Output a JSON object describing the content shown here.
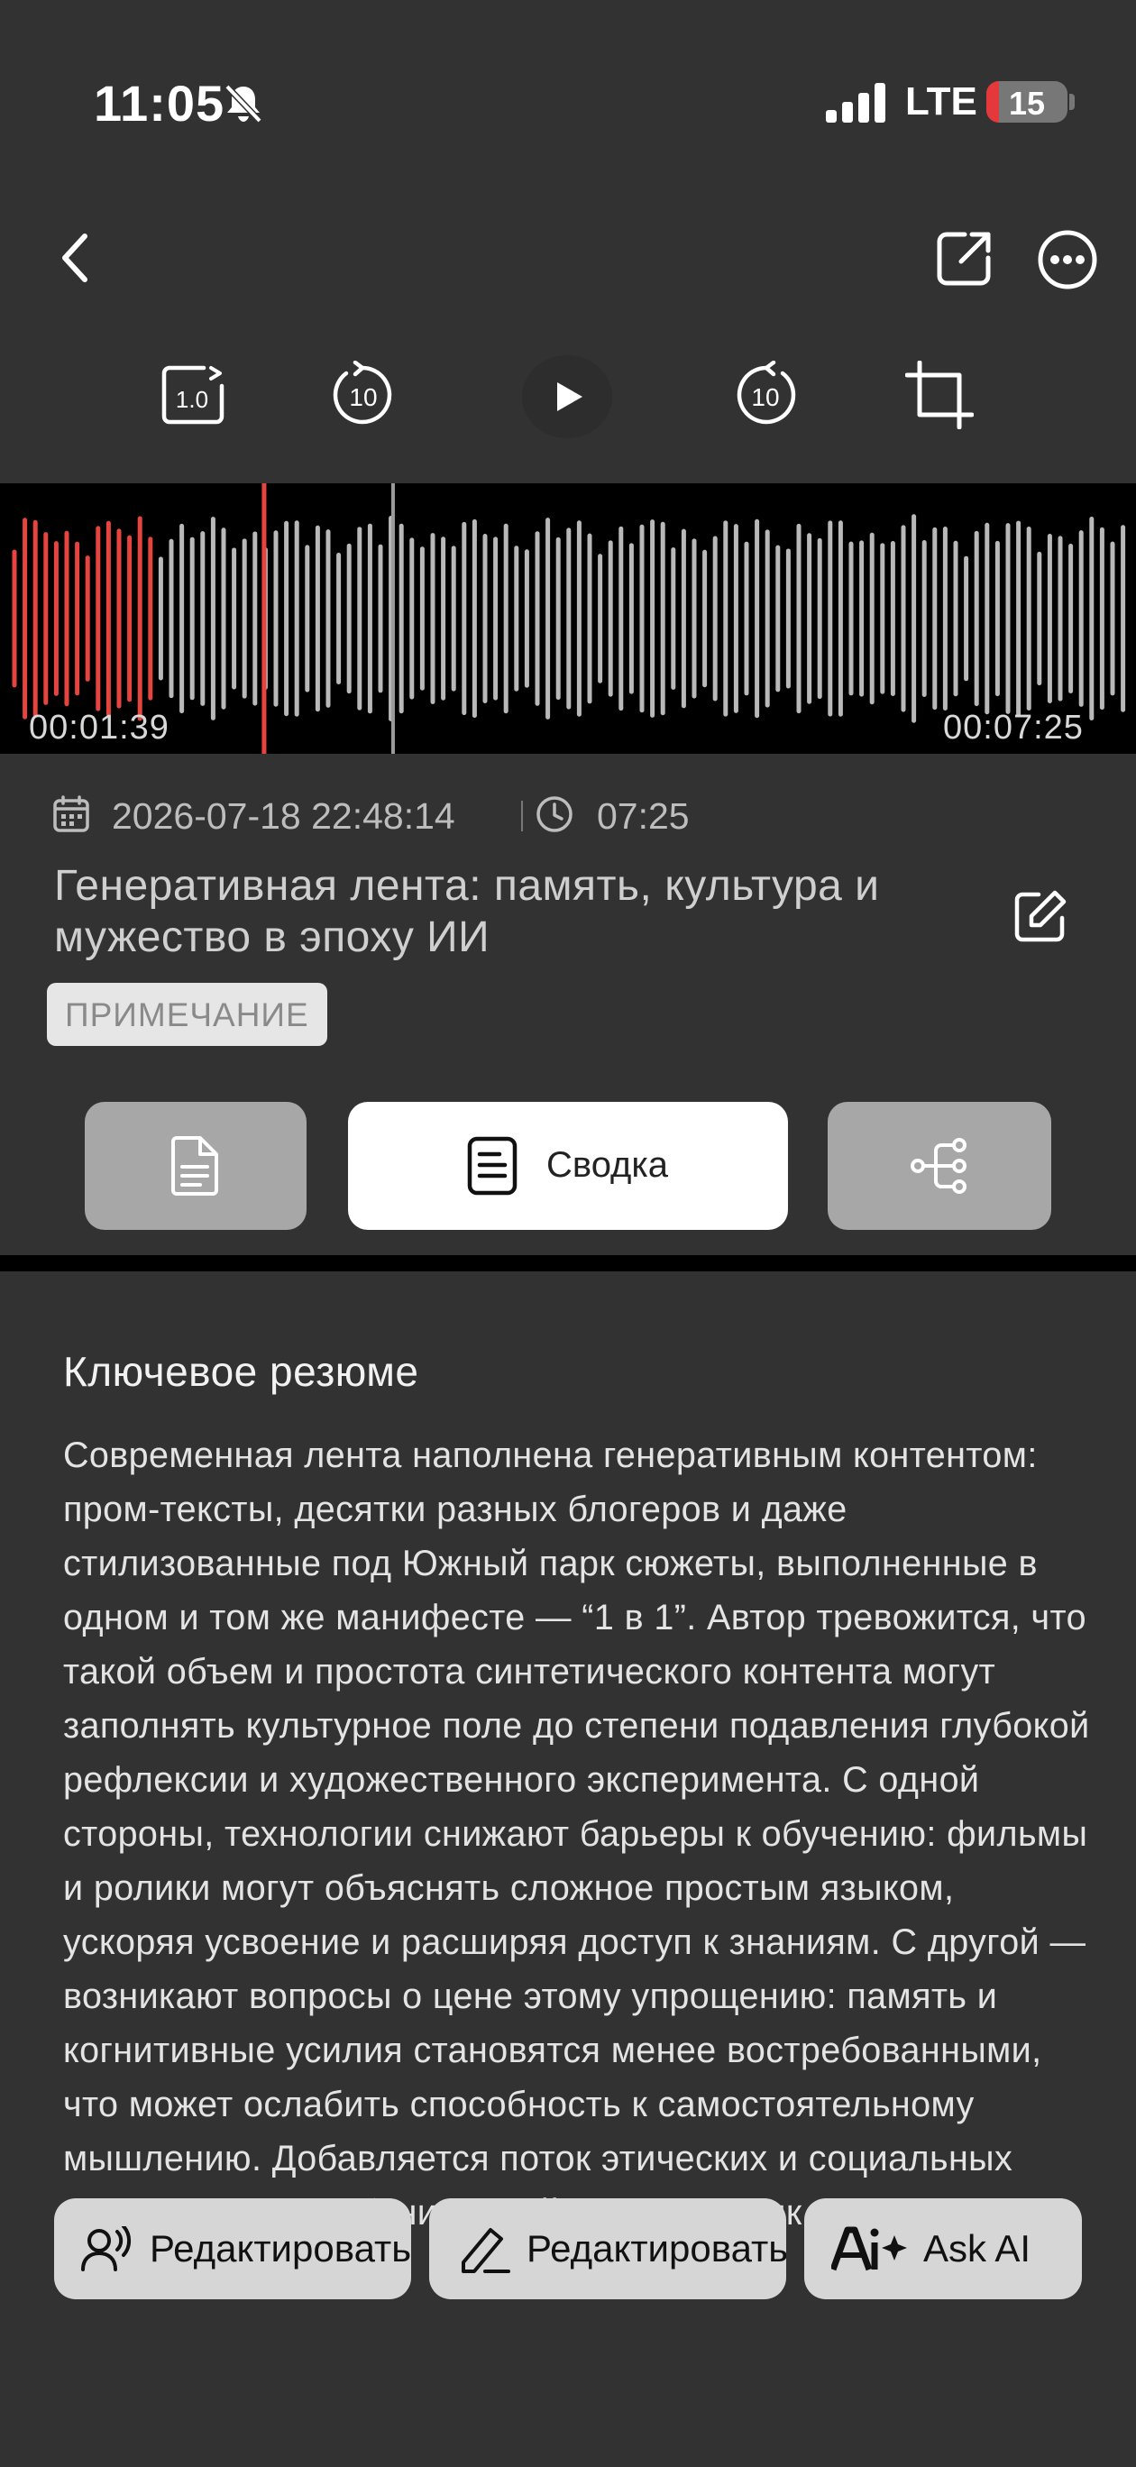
{
  "status_bar": {
    "time": "11:05",
    "network": "LTE",
    "battery_level": "15",
    "battery_fraction": 0.15
  },
  "toolbar": {
    "speed_label": "1.0",
    "rewind_seconds": "10",
    "forward_seconds": "10"
  },
  "player": {
    "current_time": "00:01:39",
    "total_time": "00:07:25",
    "progress": 0.222,
    "played_color": "#e5453e",
    "unplayed_color": "#b9b9b9"
  },
  "recording": {
    "datetime": "2026-07-18 22:48:14",
    "duration": "07:25",
    "title": "Генеративная лента: память, культура и мужество в эпоху ИИ",
    "tag": "ПРИМЕЧАНИЕ"
  },
  "tabs": {
    "summary_label": "Сводка"
  },
  "summary": {
    "heading": "Ключевое резюме",
    "body": "Современная лента наполнена генеративным контентом: пром-тексты, десятки разных блогеров и даже стилизованные под Южный парк сюжеты, выполненные в одном и том же манифесте — “1 в 1”. Автор тревожится, что такой объем и простота синтетического контента могут заполнять культурное поле до степени подавления глубокой рефлексии и художественного эксперимента. С одной стороны, технологии снижают барьеры к обучению: фильмы и ролики могут объяснять сложное простым языком, ускоряя усвоение и расширяя доступ к знаниям. С другой — возникают вопросы о цене этому упрощению: память и когнитивные усилия становятся менее востребованными, что может ослабить способность к самостоятельному мышлению. Добавляется поток этических и социальных вопросов: поколебания устойчивых практик в"
  },
  "actions": {
    "edit_speakers": "Редактировать",
    "edit_text": "Редактировать",
    "ask_ai": "Ask AI"
  }
}
